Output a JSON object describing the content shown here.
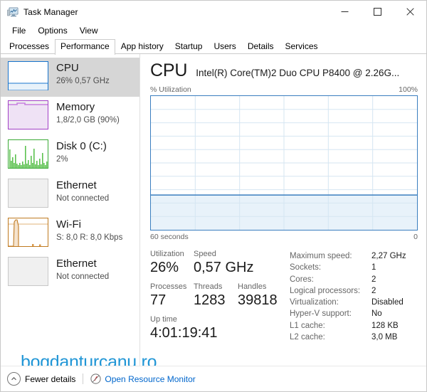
{
  "window": {
    "title": "Task Manager",
    "icon": "task-manager-icon",
    "buttons": {
      "minimize": "—",
      "maximize": "□",
      "close": "✕"
    }
  },
  "menu": {
    "items": [
      "File",
      "Options",
      "View"
    ]
  },
  "tabs": {
    "items": [
      "Processes",
      "Performance",
      "App history",
      "Startup",
      "Users",
      "Details",
      "Services"
    ],
    "active": "Performance"
  },
  "sidebar": {
    "items": [
      {
        "name": "CPU",
        "detail": "26%  0,57 GHz",
        "color": "#1874cd",
        "selected": true,
        "graph": "cpu"
      },
      {
        "name": "Memory",
        "detail": "1,8/2,0 GB (90%)",
        "color": "#a23fc6",
        "selected": false,
        "graph": "memory"
      },
      {
        "name": "Disk 0 (C:)",
        "detail": "2%",
        "color": "#3aaa35",
        "selected": false,
        "graph": "disk"
      },
      {
        "name": "Ethernet",
        "detail": "Not connected",
        "color": "#c8c8c8",
        "selected": false,
        "graph": "empty"
      },
      {
        "name": "Wi-Fi",
        "detail": "S: 8,0 R: 8,0 Kbps",
        "color": "#c07a20",
        "selected": false,
        "graph": "wifi"
      },
      {
        "name": "Ethernet",
        "detail": "Not connected",
        "color": "#c8c8c8",
        "selected": false,
        "graph": "empty"
      }
    ]
  },
  "main": {
    "title": "CPU",
    "subtitle": "Intel(R) Core(TM)2 Duo CPU P8400 @ 2.26G...",
    "graph": {
      "y_label": "% Utilization",
      "y_max_label": "100%",
      "x_left_label": "60 seconds",
      "x_right_label": "0",
      "line_color": "#3a7ebf",
      "fill_color": "#e8f2fa"
    },
    "stats": {
      "utilization_label": "Utilization",
      "utilization_value": "26%",
      "speed_label": "Speed",
      "speed_value": "0,57 GHz",
      "processes_label": "Processes",
      "processes_value": "77",
      "threads_label": "Threads",
      "threads_value": "1283",
      "handles_label": "Handles",
      "handles_value": "39818",
      "uptime_label": "Up time",
      "uptime_value": "4:01:19:41"
    },
    "info": [
      {
        "key": "Maximum speed:",
        "value": "2,27 GHz"
      },
      {
        "key": "Sockets:",
        "value": "1"
      },
      {
        "key": "Cores:",
        "value": "2"
      },
      {
        "key": "Logical processors:",
        "value": "2"
      },
      {
        "key": "Virtualization:",
        "value": "Disabled"
      },
      {
        "key": "Hyper-V support:",
        "value": "No"
      },
      {
        "key": "L1 cache:",
        "value": "128 KB"
      },
      {
        "key": "L2 cache:",
        "value": "3,0 MB"
      }
    ]
  },
  "footer": {
    "fewer_details": "Fewer details",
    "open_resource_monitor": "Open Resource Monitor"
  },
  "watermark": {
    "text": "bogdanturcanu.ro",
    "color": "#2196d6"
  },
  "chart_data": {
    "type": "area",
    "title": "CPU % Utilization",
    "ylabel": "% Utilization",
    "xlabel": "60 seconds",
    "ylim": [
      0,
      100
    ],
    "xlim": [
      60,
      0
    ],
    "grid": true,
    "grid_rows": 10,
    "grid_cols": 6,
    "current_value": 26,
    "series": [
      {
        "name": "% Utilization",
        "values": [
          26,
          26,
          26,
          26,
          26,
          26,
          26,
          26,
          26,
          26,
          26,
          26,
          26,
          26,
          26,
          26,
          26,
          26,
          26,
          26,
          26,
          26,
          26,
          26,
          26,
          26,
          26,
          26,
          26,
          26,
          26,
          26,
          26,
          26,
          26,
          26,
          26,
          26,
          26,
          26,
          26,
          26,
          26,
          26,
          26,
          26,
          26,
          26,
          26,
          26,
          26,
          26,
          26,
          26,
          26,
          26,
          26,
          26,
          26,
          26
        ]
      }
    ]
  }
}
